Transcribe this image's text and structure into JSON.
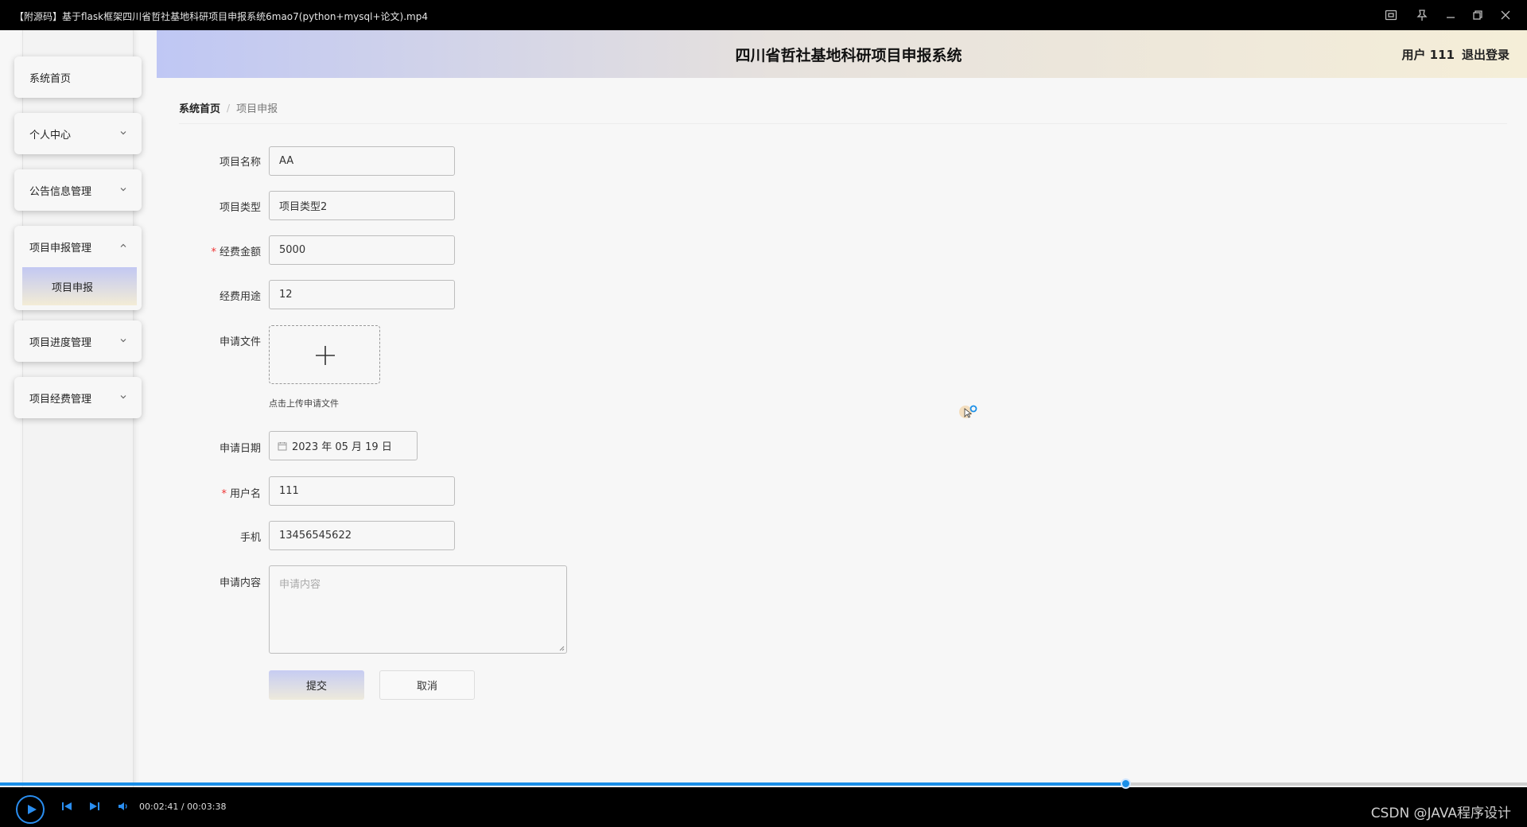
{
  "player": {
    "window_title": "【附源码】基于flask框架四川省哲社基地科研项目申报系统6mao7(python+mysql+论文).mp4",
    "time_display": "00:02:41 / 00:03:38",
    "progress_fraction": 0.737,
    "watermark": "CSDN @JAVA程序设计",
    "accent_color": "#1a8fe8"
  },
  "header": {
    "system_title": "四川省哲社基地科研项目申报系统",
    "user_label": "用户 111",
    "logout_label": "退出登录"
  },
  "sidebar": {
    "items": [
      {
        "label": "系统首页"
      },
      {
        "label": "个人中心"
      },
      {
        "label": "公告信息管理"
      },
      {
        "label": "项目申报管理",
        "expanded": true,
        "children": [
          {
            "label": "项目申报",
            "active": true
          }
        ]
      },
      {
        "label": "项目进度管理"
      },
      {
        "label": "项目经费管理"
      }
    ]
  },
  "breadcrumb": {
    "home": "系统首页",
    "separator": "/",
    "current": "项目申报"
  },
  "form": {
    "project_name": {
      "label": "项目名称",
      "value": "AA"
    },
    "project_type": {
      "label": "项目类型",
      "value": "项目类型2"
    },
    "funding_amount": {
      "label": "经费金额",
      "value": "5000",
      "required_mark": "*"
    },
    "funding_usage": {
      "label": "经费用途",
      "value": "12"
    },
    "application_file": {
      "label": "申请文件",
      "hint": "点击上传申请文件"
    },
    "application_date": {
      "label": "申请日期",
      "value": "2023 年 05 月 19 日"
    },
    "username": {
      "label": "用户名",
      "value": "111",
      "required_mark": "*"
    },
    "phone": {
      "label": "手机",
      "value": "13456545622"
    },
    "content": {
      "label": "申请内容",
      "placeholder": "申请内容"
    },
    "submit_label": "提交",
    "cancel_label": "取消"
  }
}
